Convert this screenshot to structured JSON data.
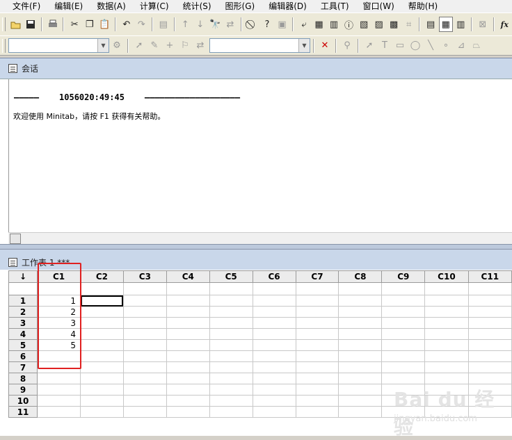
{
  "menu": [
    "文件(F)",
    "编辑(E)",
    "数据(A)",
    "计算(C)",
    "统计(S)",
    "图形(G)",
    "编辑器(D)",
    "工具(T)",
    "窗口(W)",
    "帮助(H)"
  ],
  "session": {
    "title": "会话",
    "line1": "—————    1056020:49:45    ———————————————————",
    "line2": "欢迎使用 Minitab，请按 F1 获得有关帮助。"
  },
  "worksheet": {
    "title": "工作表 1 ***",
    "corner": "↓",
    "columns": [
      "C1",
      "C2",
      "C3",
      "C4",
      "C5",
      "C6",
      "C7",
      "C8",
      "C9",
      "C10",
      "C11"
    ],
    "rows": [
      "1",
      "2",
      "3",
      "4",
      "5",
      "6",
      "7",
      "8",
      "9",
      "10",
      "11"
    ],
    "c1_values": [
      "1",
      "2",
      "3",
      "4",
      "5"
    ]
  },
  "watermark": {
    "main": "Bai du 经验",
    "sub": "jingyan.baidu.com"
  },
  "colors": {
    "highlight": "#e02020",
    "title_bar": "#c9d7ea"
  },
  "toolbar_icons": [
    "open-icon",
    "save-icon",
    "print-icon",
    "cut-icon",
    "copy-icon",
    "paste-icon",
    "undo-icon",
    "redo-icon",
    "fx-icon"
  ]
}
